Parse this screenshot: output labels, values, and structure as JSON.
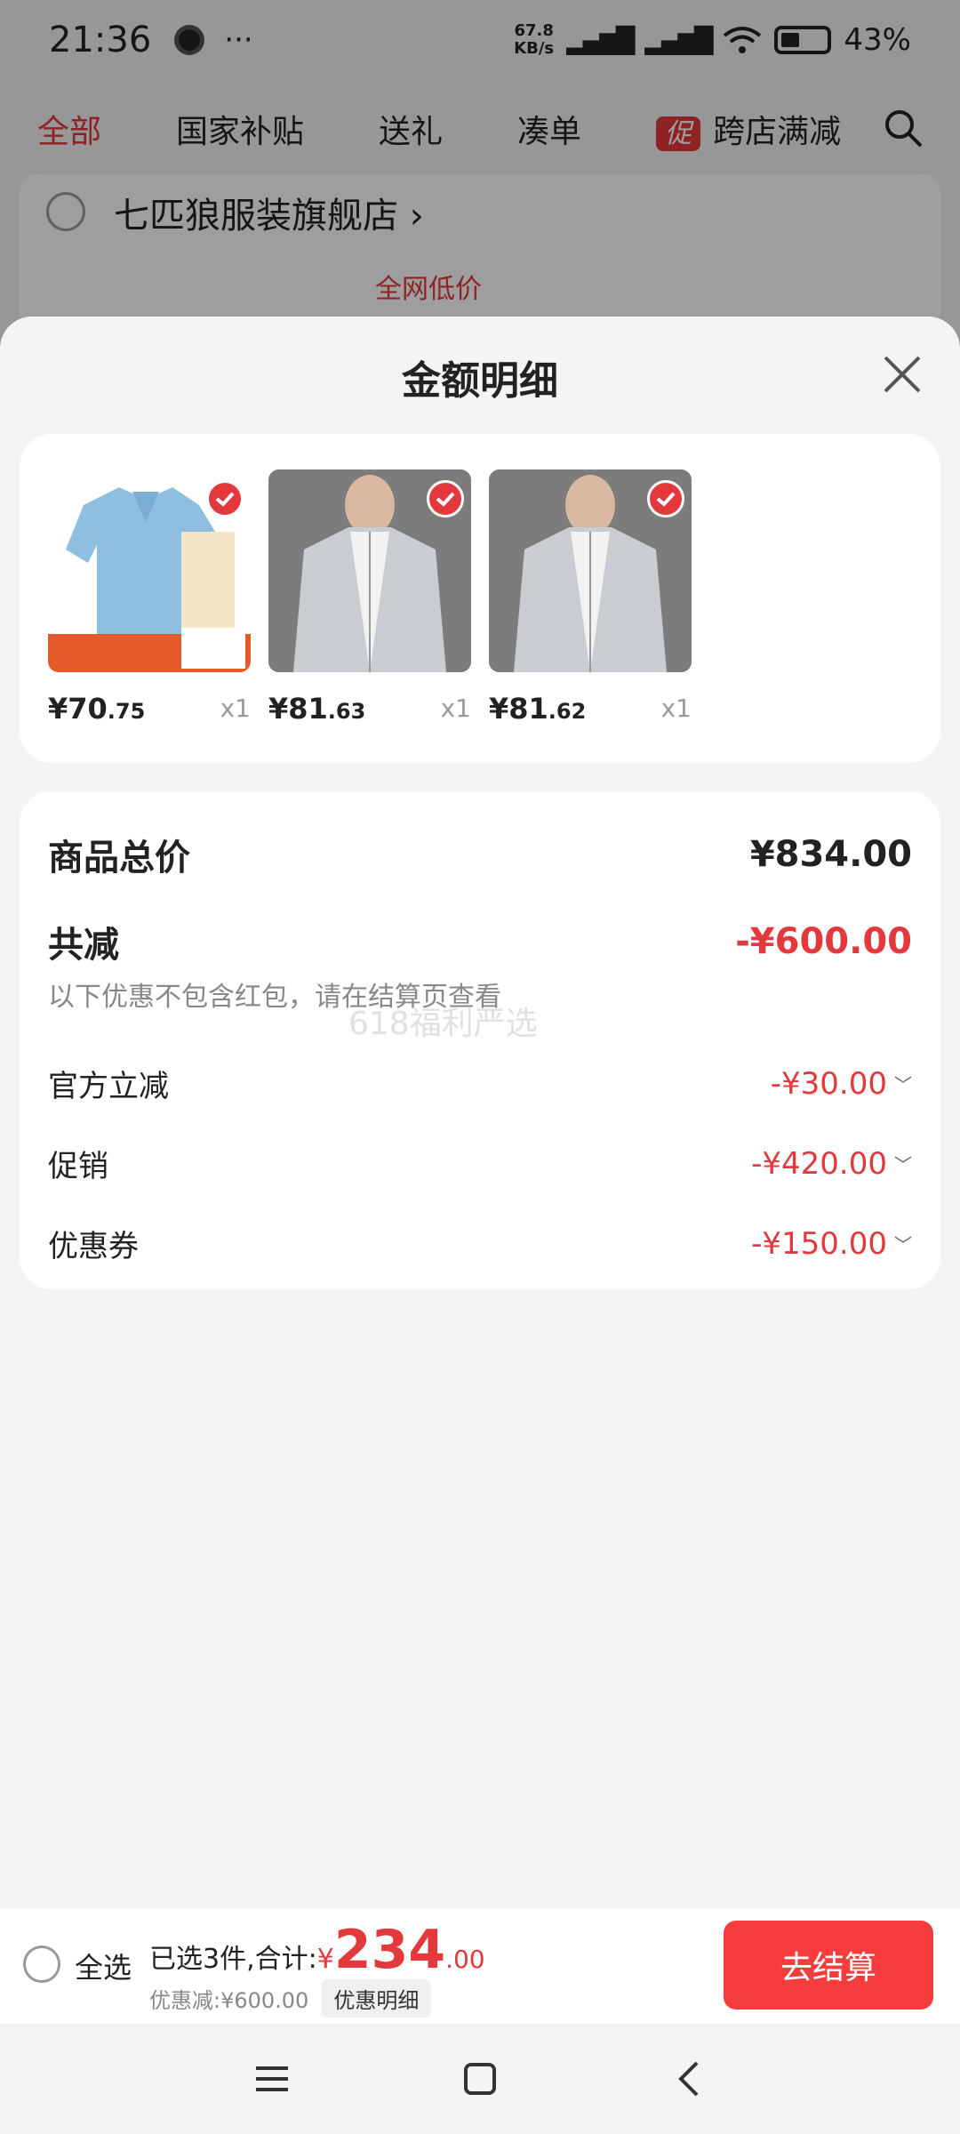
{
  "status_bar": {
    "time": "21:36",
    "more": "···",
    "net_speed_value": "67.8",
    "net_speed_unit": "KB/s",
    "battery_pct": "43%"
  },
  "top_tabs": [
    {
      "label": "全部",
      "active": true
    },
    {
      "label": "国家补贴"
    },
    {
      "label": "送礼"
    },
    {
      "label": "凑单"
    },
    {
      "label": "跨店满减"
    }
  ],
  "promo_badge": "促",
  "store": {
    "name": "七匹狼服装旗舰店",
    "chevron": "›",
    "price_tag": "全网低价"
  },
  "sheet": {
    "title": "金额明细"
  },
  "items": [
    {
      "price_int": "¥70",
      "price_dec": ".75",
      "qty": "x1",
      "image": "polo-shirt"
    },
    {
      "price_int": "¥81",
      "price_dec": ".63",
      "qty": "x1",
      "image": "jacket"
    },
    {
      "price_int": "¥81",
      "price_dec": ".62",
      "qty": "x1",
      "image": "jacket"
    }
  ],
  "summary": {
    "total_label": "商品总价",
    "total_value": "¥834.00",
    "reduce_label": "共减",
    "reduce_value": "-¥600.00",
    "note": "以下优惠不包含红包，请在结算页查看",
    "watermark": "618福利严选",
    "lines": [
      {
        "label": "官方立减",
        "value": "-¥30.00"
      },
      {
        "label": "促销",
        "value": "-¥420.00"
      },
      {
        "label": "优惠券",
        "value": "-¥150.00"
      }
    ]
  },
  "bottom_bar": {
    "select_all": "全选",
    "selected_text": "已选3件,合计:",
    "currency": "¥",
    "total_int": "234",
    "total_dec": ".00",
    "discount_text": "优惠减:¥600.00",
    "detail_chip": "优惠明细",
    "checkout": "去结算"
  },
  "colors": {
    "accent": "#e4393c",
    "checkout_bg": "#f53d3d"
  }
}
